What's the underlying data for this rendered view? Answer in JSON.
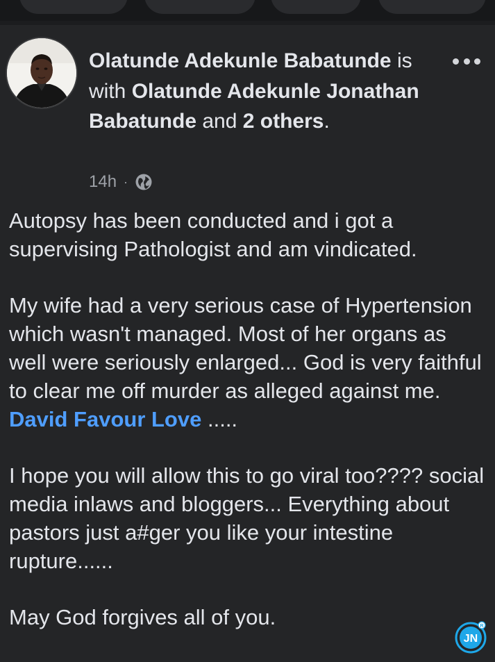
{
  "post": {
    "author": "Olatunde Adekunle Babatunde",
    "is_with": "is",
    "with_word": "with",
    "tagged_person": "Olatunde Adekunle Jonathan Babatunde",
    "and_word": "and",
    "others": "2 others",
    "end_period": ".",
    "time": "14h",
    "separator": "·",
    "audience_icon": "globe-icon",
    "more_icon": "more-options-icon",
    "paragraph1": "Autopsy has been conducted and i got a supervising Pathologist and am vindicated.",
    "paragraph2_text": "My wife had a very serious case of Hypertension which wasn't managed. Most of her organs as well were seriously enlarged... God is very faithful to clear me off murder as alleged against me.",
    "mention": "David Favour Love",
    "paragraph2_tail": ".....",
    "paragraph3": "I hope you will allow this to go viral too???? social media inlaws and bloggers... Everything about pastors just a#ger you like your intestine rupture......",
    "paragraph4": "May God forgives all of you."
  },
  "watermark": {
    "label": "JN",
    "registered": "R"
  },
  "colors": {
    "background": "#242527",
    "text": "#e4e6eb",
    "secondary_text": "#9ea2a8",
    "link": "#4f9eff",
    "watermark": "#1ea7e8"
  }
}
